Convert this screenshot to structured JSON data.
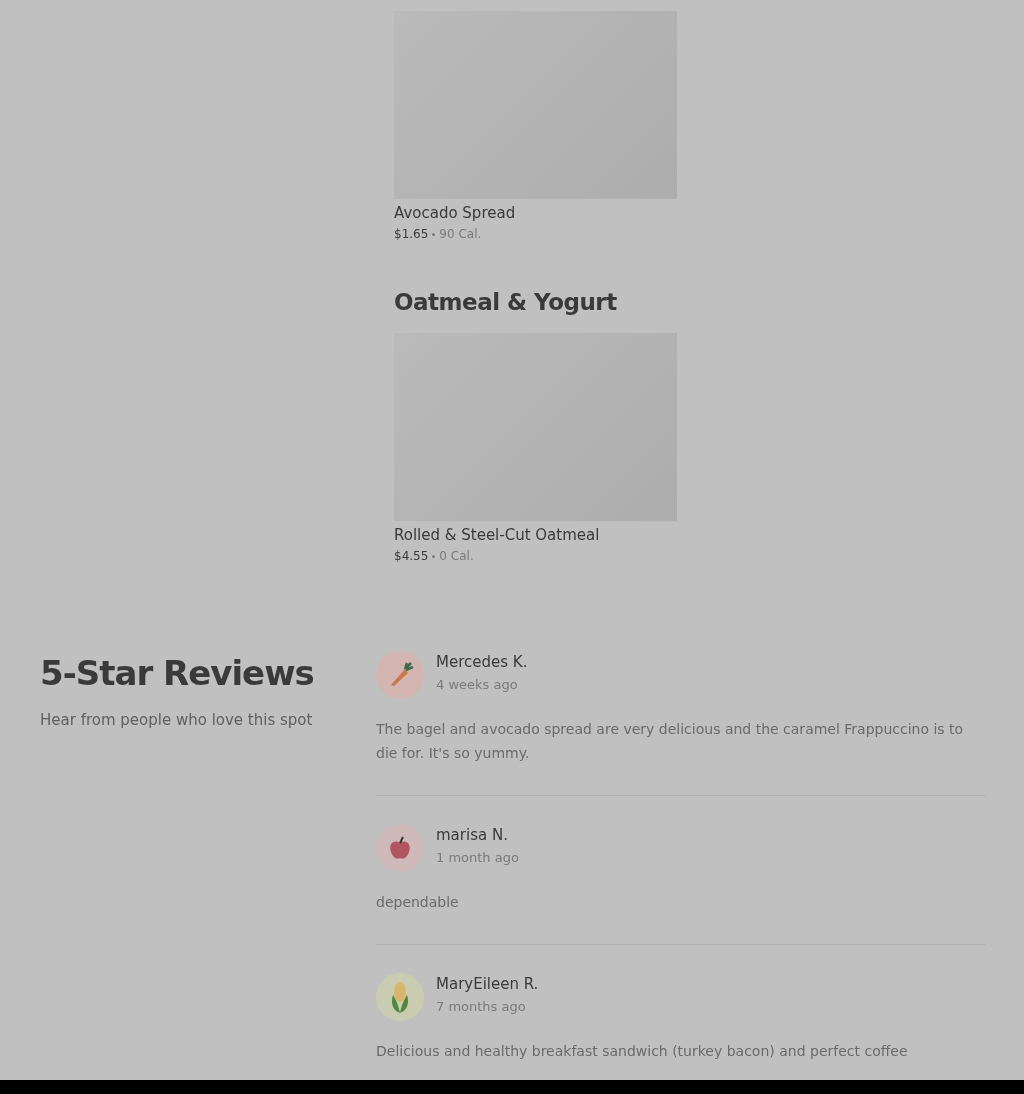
{
  "menu_sections": [
    {
      "items": [
        {
          "name": "Avocado Spread",
          "price": "$1.65",
          "calories": "90 Cal."
        }
      ]
    },
    {
      "heading": "Oatmeal & Yogurt",
      "items": [
        {
          "name": "Rolled & Steel-Cut Oatmeal",
          "price": "$4.55",
          "calories": "0 Cal."
        }
      ]
    }
  ],
  "reviews_section": {
    "title": "5-Star Reviews",
    "subtitle": "Hear from people who love this spot",
    "reviews": [
      {
        "kind": "carrot",
        "name": "Mercedes K.",
        "time": "4 weeks ago",
        "text": "The bagel and avocado spread are very delicious and the caramel Frappuccino is to die for. It's so yummy."
      },
      {
        "kind": "apple",
        "name": "marisa N.",
        "time": "1 month ago",
        "text": "dependable"
      },
      {
        "kind": "corn",
        "name": "MaryEileen R.",
        "time": "7 months ago",
        "text": "Delicious and healthy breakfast sandwich (turkey bacon) and perfect coffee"
      }
    ]
  }
}
